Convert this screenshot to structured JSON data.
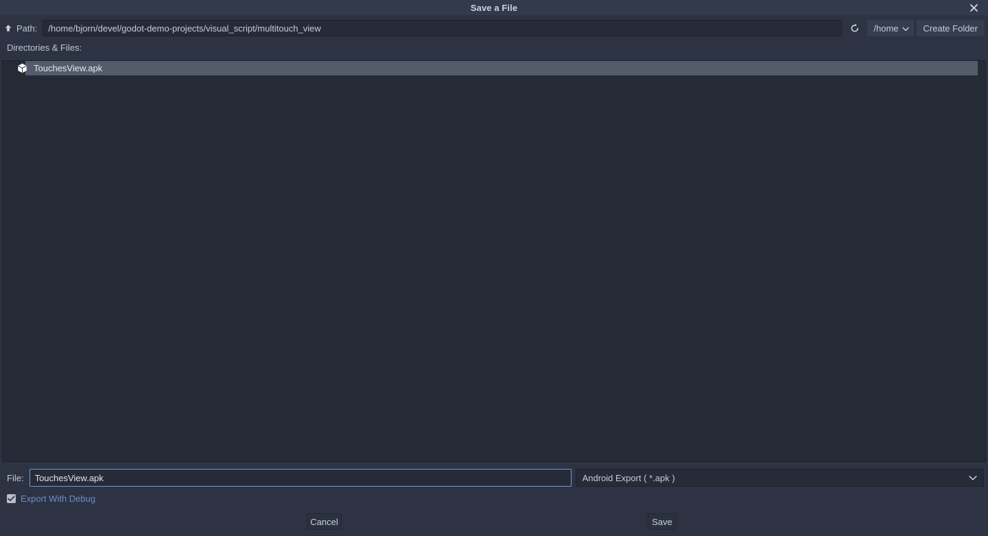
{
  "window": {
    "title": "Save a File",
    "close_icon": "close-icon"
  },
  "path_bar": {
    "up_icon": "arrow-up-icon",
    "label": "Path:",
    "value": "/home/bjorn/devel/godot-demo-projects/visual_script/multitouch_view",
    "placeholder": "",
    "refresh_icon": "refresh-icon",
    "drive_label": "/home",
    "drive_chevron_icon": "chevron-down-icon",
    "create_folder_label": "Create Folder"
  },
  "browser": {
    "section_label": "Directories & Files:",
    "items": [
      {
        "name": "TouchesView.apk",
        "icon": "package-icon",
        "selected": true
      }
    ]
  },
  "file_bar": {
    "label": "File:",
    "value": "TouchesView.apk",
    "placeholder": "",
    "filter_selected": "Android Export ( *.apk )",
    "filter_chevron_icon": "chevron-down-icon"
  },
  "options": {
    "export_with_debug": {
      "label": "Export With Debug",
      "checked": true,
      "check_icon": "check-icon"
    }
  },
  "footer": {
    "cancel_label": "Cancel",
    "save_label": "Save"
  },
  "colors": {
    "window_background": "#2d3343",
    "titlebar": "#333a4c",
    "panel": "#242a36",
    "input": "#262b37",
    "selection": "#545b6b",
    "accent_focus": "#6f9bd8",
    "link_text": "#6d8dc9",
    "text": "#c5ccd8"
  }
}
